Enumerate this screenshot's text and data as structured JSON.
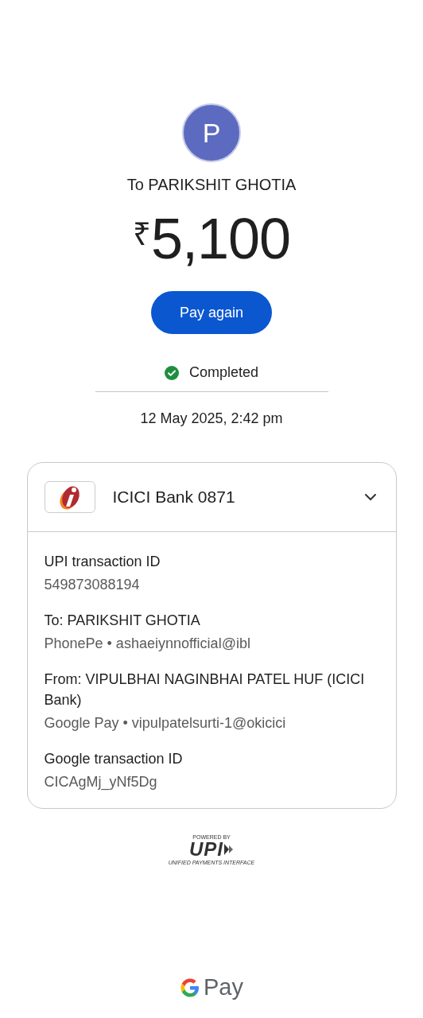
{
  "payee": {
    "initial": "P",
    "color": "#5c6bc0",
    "title": "To PARIKSHIT GHOTIA"
  },
  "amount": {
    "currency": "₹",
    "value": "5,100"
  },
  "action": {
    "label": "Pay again"
  },
  "status": {
    "kind": "completed",
    "label": "Completed"
  },
  "date": "12 May 2025, 2:42 pm",
  "account": {
    "name": "ICICI Bank 0871",
    "expanded": true,
    "details": [
      {
        "label": "UPI transaction ID",
        "value": "549873088194"
      },
      {
        "label": "To: PARIKSHIT GHOTIA",
        "value": "PhonePe • ashaeiynnofficial@ibl"
      },
      {
        "label": "From: VIPULBHAI NAGINBHAI PATEL HUF (ICICI Bank)",
        "value": "Google Pay • vipulpatelsurti-1@okicici"
      },
      {
        "label": "Google transaction ID",
        "value": "CICAgMj_yNf5Dg"
      }
    ]
  },
  "upi_logo": {
    "caption": "POWERED BY",
    "mark": "UPI",
    "subtitle": "UNIFIED PAYMENTS INTERFACE"
  },
  "footer_logo": {
    "text": "Pay"
  }
}
